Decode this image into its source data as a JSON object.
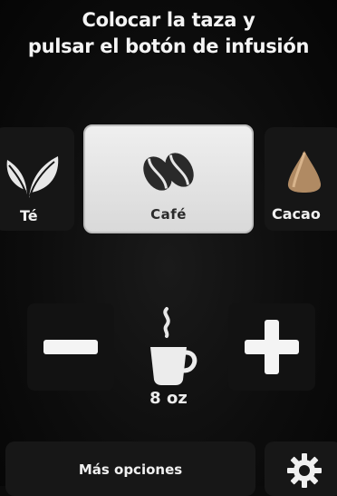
{
  "instruction": {
    "line1": "Colocar la taza y",
    "line2": "pulsar el botón de infusión"
  },
  "beverages": [
    {
      "label": "Té",
      "icon": "tea-leaves-icon",
      "selected": false
    },
    {
      "label": "Café",
      "icon": "coffee-beans-icon",
      "selected": true
    },
    {
      "label": "Cacao",
      "icon": "cocoa-drop-icon",
      "selected": false
    }
  ],
  "size": {
    "value": "8 oz",
    "decrease_icon": "minus-icon",
    "increase_icon": "plus-icon",
    "cup_icon": "steaming-cup-icon"
  },
  "footer": {
    "more_options_label": "Más opciones",
    "settings_icon": "gear-icon"
  },
  "colors": {
    "background": "#0b0b0b",
    "selected_tile": "#e6e6e6",
    "tile": "#161616",
    "text": "#f2f2f2"
  }
}
